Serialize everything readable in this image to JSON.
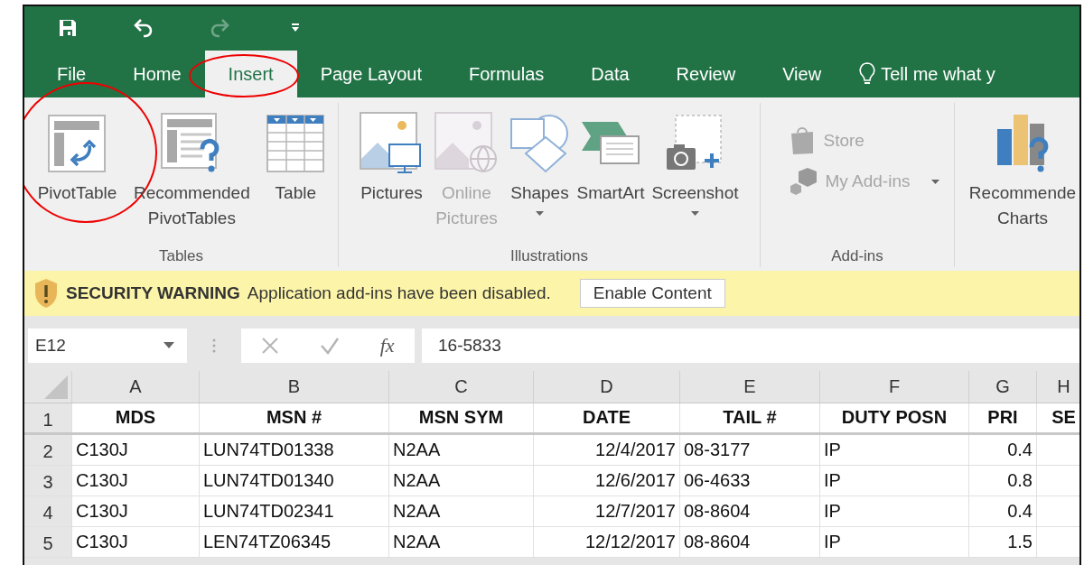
{
  "quick_access": [
    {
      "kind": "save",
      "disabled": false
    },
    {
      "kind": "undo",
      "disabled": false
    },
    {
      "kind": "redo",
      "disabled": true
    },
    {
      "kind": "customize",
      "disabled": false
    }
  ],
  "tabs": [
    {
      "label": "File",
      "selected": false,
      "circled": false
    },
    {
      "label": "Home",
      "selected": false,
      "circled": false
    },
    {
      "label": "Insert",
      "selected": true,
      "circled": true
    },
    {
      "label": "Page Layout",
      "selected": false,
      "circled": false
    },
    {
      "label": "Formulas",
      "selected": false,
      "circled": false
    },
    {
      "label": "Data",
      "selected": false,
      "circled": false
    },
    {
      "label": "Review",
      "selected": false,
      "circled": false
    },
    {
      "label": "View",
      "selected": false,
      "circled": false
    }
  ],
  "tell_me": "Tell me what y",
  "ribbon_groups": [
    {
      "label": "Tables",
      "commands": [
        {
          "kind": "large",
          "label": "PivotTable",
          "disabled": false,
          "dropdown": false,
          "circled": true
        },
        {
          "kind": "large",
          "label": "Recommended PivotTables",
          "disabled": false,
          "dropdown": false,
          "circled": false
        },
        {
          "kind": "large",
          "label": "Table",
          "disabled": false,
          "dropdown": false,
          "circled": false
        }
      ]
    },
    {
      "label": "Illustrations",
      "commands": [
        {
          "kind": "large",
          "label": "Pictures",
          "disabled": false,
          "dropdown": false,
          "circled": false
        },
        {
          "kind": "large",
          "label": "Online Pictures",
          "disabled": true,
          "dropdown": false,
          "circled": false
        },
        {
          "kind": "large",
          "label": "Shapes",
          "disabled": false,
          "dropdown": true,
          "circled": false
        },
        {
          "kind": "large",
          "label": "SmartArt",
          "disabled": false,
          "dropdown": false,
          "circled": false
        },
        {
          "kind": "large",
          "label": "Screenshot",
          "disabled": false,
          "dropdown": true,
          "circled": false
        }
      ]
    },
    {
      "label": "Add-ins",
      "commands": [
        {
          "kind": "small",
          "label": "Store",
          "disabled": true,
          "dropdown": false,
          "circled": false
        },
        {
          "kind": "small",
          "label": "My Add-ins",
          "disabled": true,
          "dropdown": true,
          "circled": false
        }
      ]
    },
    {
      "commands": [
        {
          "kind": "large",
          "label": "Recommende Charts",
          "disabled": false,
          "dropdown": false,
          "circled": false
        }
      ]
    }
  ],
  "security_bar": {
    "title": "SECURITY WARNING",
    "message": "Application add-ins have been disabled.",
    "button": "Enable Content"
  },
  "formula_bar": {
    "name_box": "E12",
    "fx": "fx",
    "formula": "16-5833"
  },
  "sheet": {
    "columns": [
      "A",
      "B",
      "C",
      "D",
      "E",
      "F",
      "G",
      "H"
    ],
    "rows": [
      {
        "number": "1",
        "kind": "header",
        "cells": [
          "MDS",
          "MSN #",
          "MSN SYM",
          "DATE",
          "TAIL #",
          "DUTY POSN",
          "PRI",
          "SE"
        ]
      },
      {
        "number": "2",
        "kind": "data",
        "cells": [
          "C130J",
          "LUN74TD01338",
          "N2AA",
          "12/4/2017",
          "08-3177",
          "IP",
          "0.4"
        ]
      },
      {
        "number": "3",
        "kind": "data",
        "cells": [
          "C130J",
          "LUN74TD01340",
          "N2AA",
          "12/6/2017",
          "06-4633",
          "IP",
          "0.8"
        ]
      },
      {
        "number": "4",
        "kind": "data",
        "cells": [
          "C130J",
          "LUN74TD02341",
          "N2AA",
          "12/7/2017",
          "08-8604",
          "IP",
          "0.4"
        ]
      },
      {
        "number": "5",
        "kind": "data",
        "cells": [
          "C130J",
          "LEN74TZ06345",
          "N2AA",
          "12/12/2017",
          "08-8604",
          "IP",
          "1.5"
        ]
      }
    ]
  }
}
